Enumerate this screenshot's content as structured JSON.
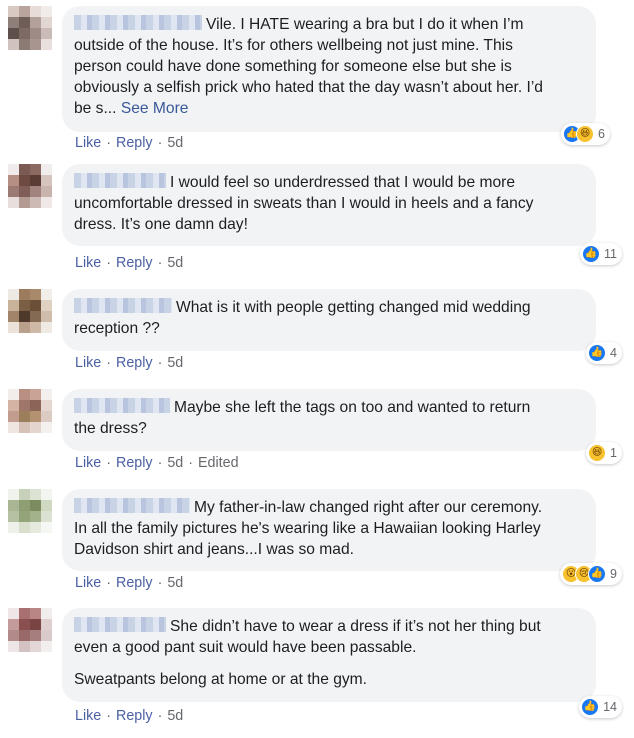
{
  "comments": [
    {
      "text_lines": [
        "Vile. I HATE wearing a bra but I do it when I’m",
        "outside of the house. It’s for others wellbeing not just mine. This",
        "person could have done something for someone else but she is",
        "obviously a selfish prick who hated that the day wasn’t about her. I’d",
        "be s..."
      ],
      "see_more": "See More",
      "reactions": [
        "like",
        "haha"
      ],
      "reaction_count": "6",
      "like_label": "Like",
      "reply_label": "Reply",
      "time": "5d",
      "edited": ""
    },
    {
      "text_lines": [
        "I would feel so underdressed that I would be more",
        "uncomfortable dressed in sweats than I would in heels and a fancy",
        "dress. It’s one damn day!"
      ],
      "reactions": [
        "like"
      ],
      "reaction_count": "11",
      "like_label": "Like",
      "reply_label": "Reply",
      "time": "5d",
      "edited": ""
    },
    {
      "text_lines": [
        "What is it with people getting changed mid wedding",
        "reception ??"
      ],
      "reactions": [
        "like"
      ],
      "reaction_count": "4",
      "like_label": "Like",
      "reply_label": "Reply",
      "time": "5d",
      "edited": ""
    },
    {
      "text_lines": [
        "Maybe she left the tags on too and wanted to return",
        "the dress?"
      ],
      "reactions": [
        "haha"
      ],
      "reaction_count": "1",
      "like_label": "Like",
      "reply_label": "Reply",
      "time": "5d",
      "edited": "Edited"
    },
    {
      "text_lines": [
        "My father-in-law changed right after our ceremony.",
        "In all the family pictures he's wearing like a Hawaiian looking Harley",
        "Davidson shirt and jeans...I was so mad."
      ],
      "reactions": [
        "wow",
        "sad",
        "like"
      ],
      "reaction_count": "9",
      "like_label": "Like",
      "reply_label": "Reply",
      "time": "5d",
      "edited": ""
    },
    {
      "text_lines": [
        "She didn’t have to wear a dress if it’s not her thing but",
        "even a good pant suit would have been passable."
      ],
      "text_para2": "Sweatpants belong at home or at the gym.",
      "reactions": [
        "like"
      ],
      "reaction_count": "14",
      "like_label": "Like",
      "reply_label": "Reply",
      "time": "5d",
      "edited": ""
    }
  ],
  "colors": {
    "bubble": "#f2f3f5",
    "link": "#4b5fa3",
    "see_more": "#385898",
    "like_blue": "#1877f2",
    "emoji_yellow": "#f7c22e"
  }
}
